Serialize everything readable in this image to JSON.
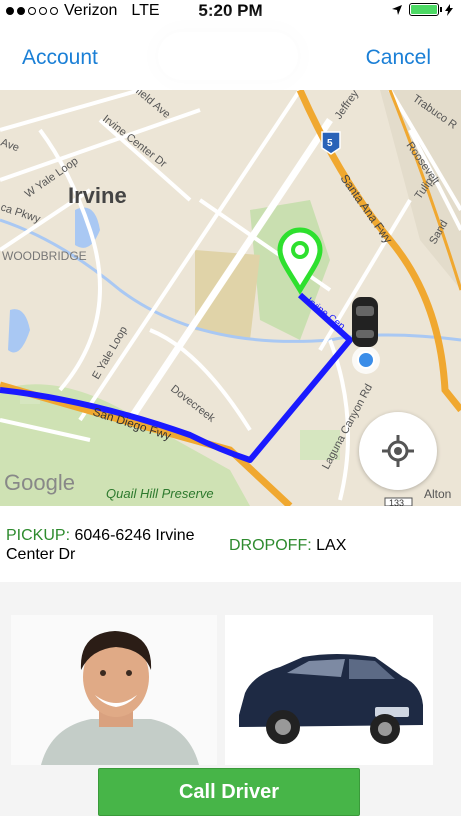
{
  "status_bar": {
    "carrier": "Verizon",
    "network": "LTE",
    "time": "5:20 PM"
  },
  "nav": {
    "left_label": "Account",
    "right_label": "Cancel"
  },
  "map": {
    "city": "Irvine",
    "labels": {
      "woodbridge": "WOODBRIDGE",
      "w_yale_loop": "W Yale Loop",
      "irvine_center_dr": "Irvine Center Dr",
      "e_yale_loop": "E Yale Loop",
      "irvine_center_short": "Irvine Cen",
      "san_diego_fwy": "San Diego Fwy",
      "dovecreek": "Dovecreek",
      "laguna_canyon_rd": "Laguna Canyon Rd",
      "santa_ana_fwy": "Santa Ana Fwy",
      "quail_hill": "Quail Hill Preserve",
      "jeffrey": "Jeffrey",
      "trabuco": "Trabuco R",
      "roosevelt": "Roosevelt",
      "tulip": "Tulip",
      "sand": "Sand",
      "ave_top_left": "Ave",
      "field_ave": "field Ave",
      "ca_pkwy": "ca Pkwy",
      "alton": "Alton",
      "google": "Google",
      "route_5": "5",
      "route_133": "133"
    }
  },
  "pickup": {
    "label": "PICKUP:",
    "address": "6046-6246 Irvine Center Dr"
  },
  "dropoff": {
    "label": "DROPOFF:",
    "address": "LAX"
  },
  "call_button": "Call Driver",
  "colors": {
    "accent_blue": "#1a7fd6",
    "route": "#1a1aff",
    "pin_green": "#2ee02e",
    "button_green": "#47b548",
    "label_green": "#2e8b2e"
  },
  "icons": {
    "location_arrow": "location-arrow-icon",
    "locate": "crosshair-icon",
    "pickup_pin": "map-pin-icon",
    "car": "car-icon"
  }
}
